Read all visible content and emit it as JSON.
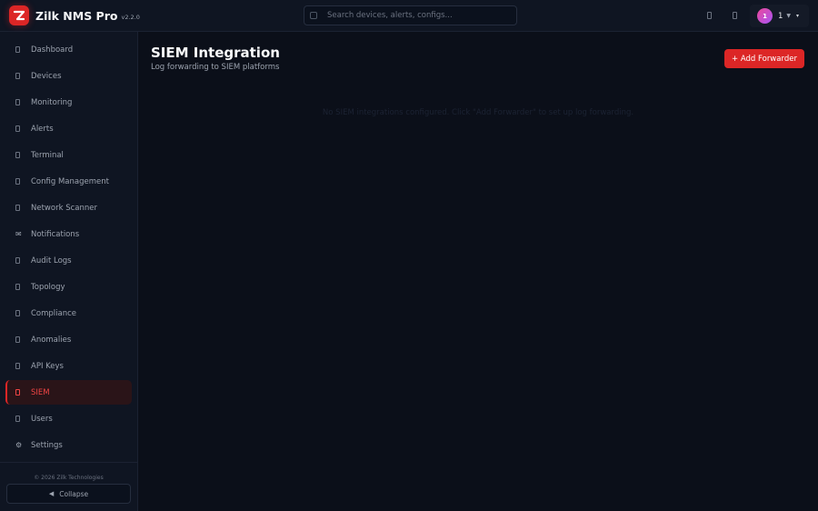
{
  "app": {
    "name": "Zilk NMS Pro",
    "version": "v2.2.0"
  },
  "search": {
    "placeholder": "Search devices, alerts, configs..."
  },
  "user": {
    "avatar_letter": "1",
    "name": "1",
    "status_glyph": "▼",
    "caret": "▾"
  },
  "sidebar": {
    "items": [
      {
        "label": "Dashboard",
        "icon": "dashboard-icon"
      },
      {
        "label": "Devices",
        "icon": "devices-icon"
      },
      {
        "label": "Monitoring",
        "icon": "monitoring-icon"
      },
      {
        "label": "Alerts",
        "icon": "alerts-icon"
      },
      {
        "label": "Terminal",
        "icon": "terminal-icon"
      },
      {
        "label": "Config Management",
        "icon": "config-icon"
      },
      {
        "label": "Network Scanner",
        "icon": "scanner-icon"
      },
      {
        "label": "Notifications",
        "icon": "mail-icon",
        "glyph": "✉"
      },
      {
        "label": "Audit Logs",
        "icon": "audit-icon"
      },
      {
        "label": "Topology",
        "icon": "topology-icon"
      },
      {
        "label": "Compliance",
        "icon": "compliance-icon"
      },
      {
        "label": "Anomalies",
        "icon": "anomalies-icon"
      },
      {
        "label": "API Keys",
        "icon": "key-icon"
      },
      {
        "label": "SIEM",
        "icon": "siem-icon",
        "active": true
      },
      {
        "label": "Users",
        "icon": "users-icon"
      },
      {
        "label": "Settings",
        "icon": "gear-icon",
        "glyph": "⚙"
      }
    ],
    "copyright": "© 2026 Zilk Technologies",
    "collapse_label": "Collapse",
    "collapse_glyph": "◀"
  },
  "page": {
    "title": "SIEM Integration",
    "subtitle": "Log forwarding to SIEM platforms",
    "add_button": "+ Add Forwarder",
    "empty_state": "No SIEM integrations configured. Click \"Add Forwarder\" to set up log forwarding."
  },
  "colors": {
    "accent": "#dc2626",
    "background": "#0b0f19",
    "sidebar": "#0f1522"
  }
}
